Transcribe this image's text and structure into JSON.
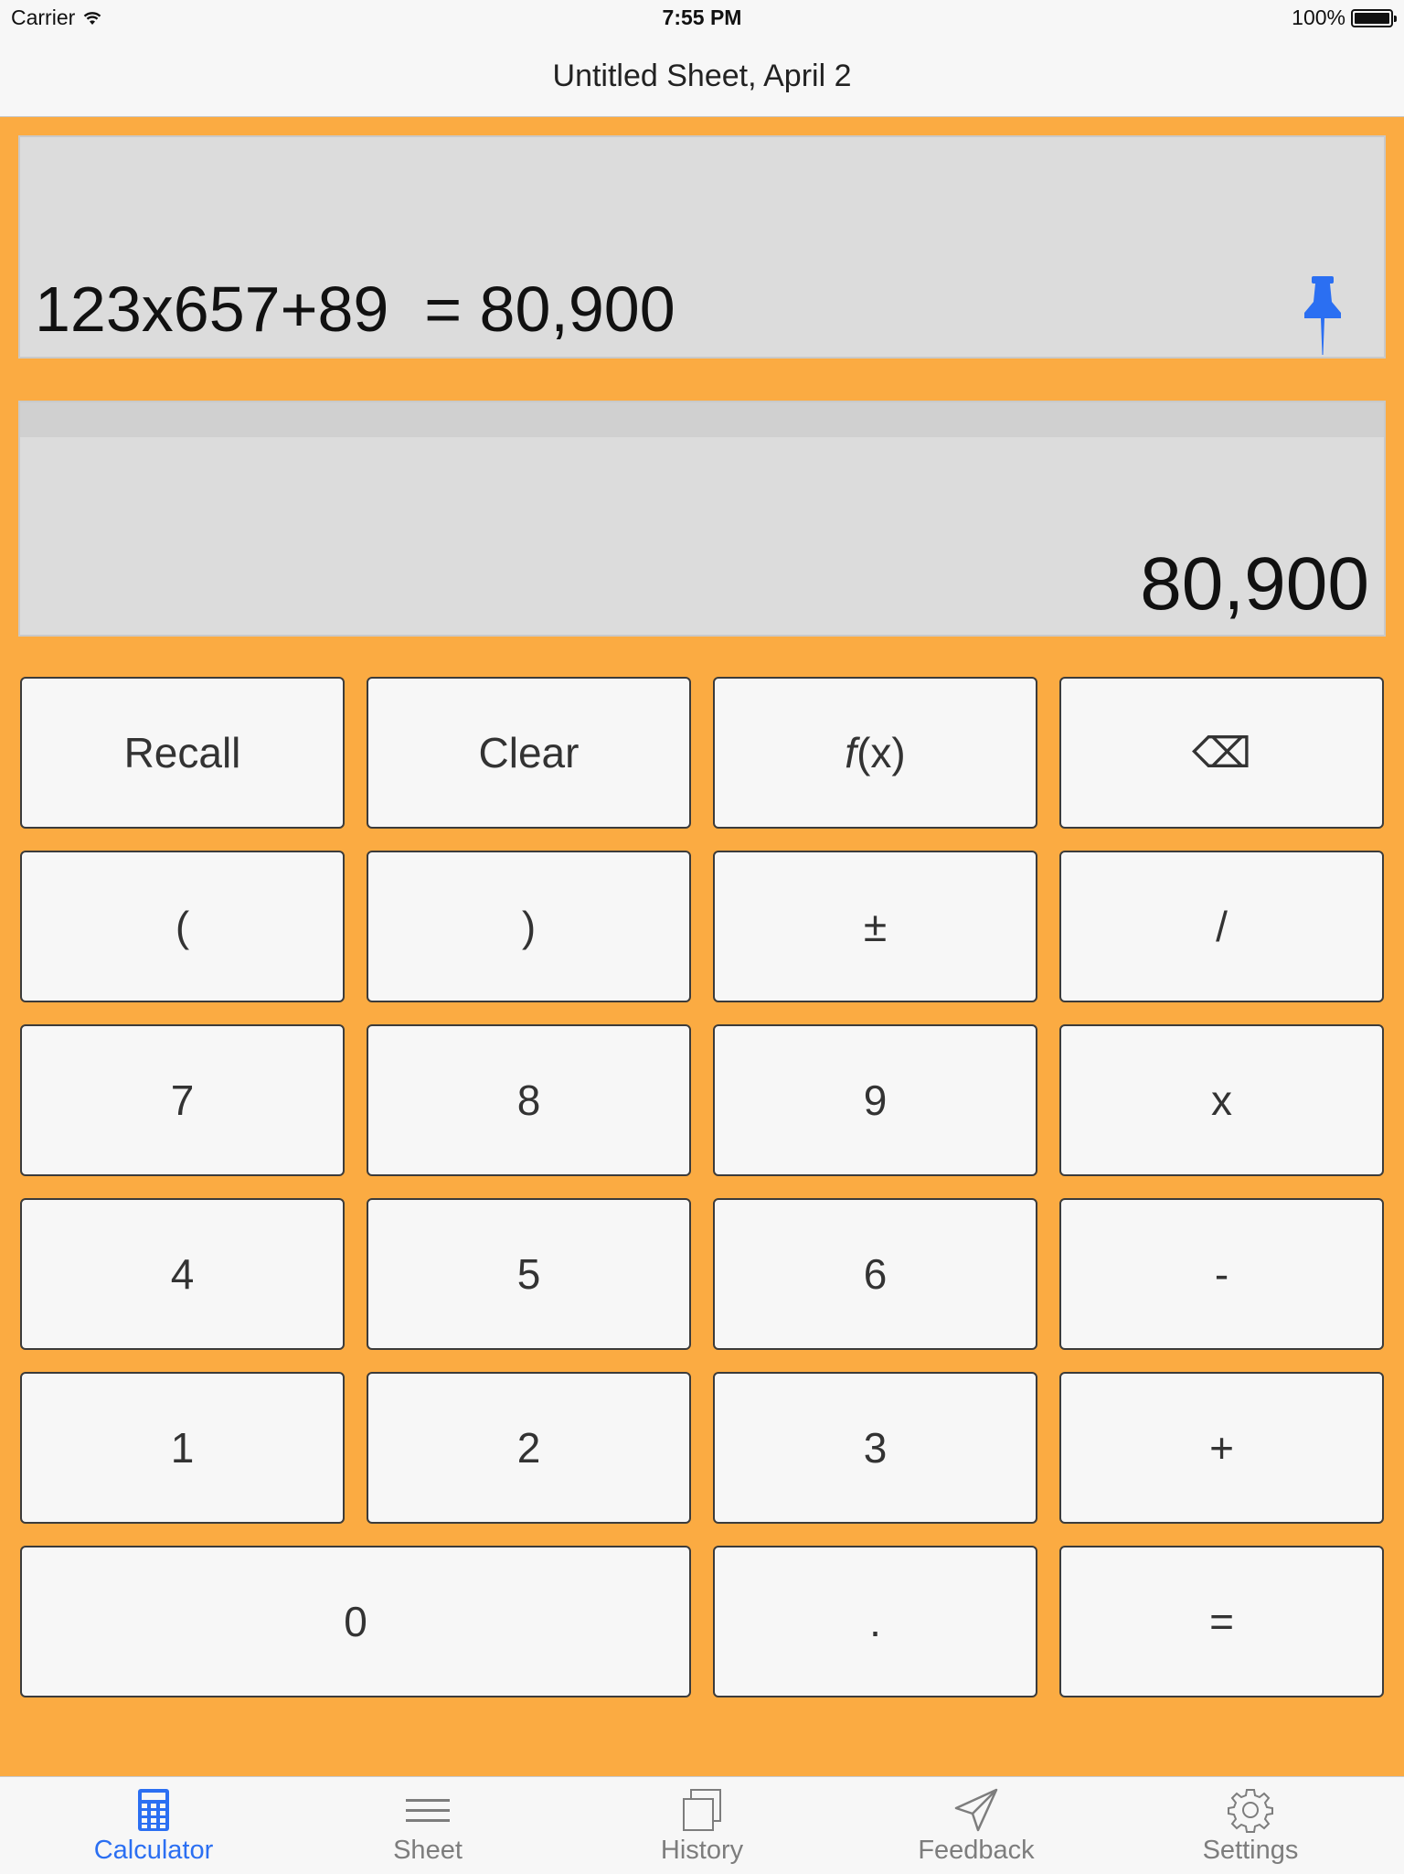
{
  "status_bar": {
    "carrier": "Carrier",
    "time": "7:55 PM",
    "battery": "100%"
  },
  "title": "Untitled Sheet, April 2",
  "expression": "123x657+89  = 80,900",
  "result": "80,900",
  "keys": {
    "recall": "Recall",
    "clear": "Clear",
    "fx_f": "f",
    "fx_rest": "(x)",
    "backspace": "⌫",
    "lparen": "(",
    "rparen": ")",
    "plusminus": "±",
    "divide": "/",
    "k7": "7",
    "k8": "8",
    "k9": "9",
    "multiply": "x",
    "k4": "4",
    "k5": "5",
    "k6": "6",
    "minus": "-",
    "k1": "1",
    "k2": "2",
    "k3": "3",
    "plus": "+",
    "k0": "0",
    "dot": ".",
    "equals": "="
  },
  "tabs": [
    {
      "label": "Calculator",
      "icon": "calculator-icon",
      "active": true
    },
    {
      "label": "Sheet",
      "icon": "sheet-icon"
    },
    {
      "label": "History",
      "icon": "history-icon"
    },
    {
      "label": "Feedback",
      "icon": "feedback-icon"
    },
    {
      "label": "Settings",
      "icon": "gear-icon"
    }
  ],
  "colors": {
    "accent": "#2b6ff2",
    "background": "#fbab42",
    "panel": "#dcdcdc"
  }
}
